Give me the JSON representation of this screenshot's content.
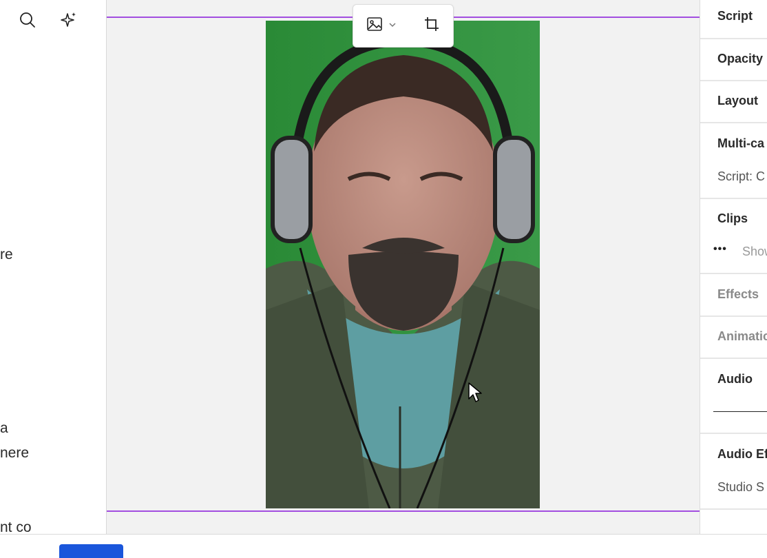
{
  "left_panel": {
    "icons": {
      "search": "search-icon",
      "ai": "sparkle-icon"
    },
    "text_fragments": [
      "re",
      "a",
      "nere",
      "nt co"
    ]
  },
  "canvas": {
    "toolbar": {
      "image_button": "image-icon",
      "dropdown": "chevron-down-icon",
      "crop_button": "crop-icon"
    },
    "guide_color": "#a24de0",
    "video_background": "#2d8b3a"
  },
  "right_panel": {
    "sections": {
      "script": "Script",
      "opacity": "Opacity",
      "layout": "Layout",
      "multicam": "Multi-ca",
      "multicam_sub": "Script: C",
      "clips": "Clips",
      "clips_sub": "Show",
      "effects": "Effects",
      "animation": "Animatic",
      "audio": "Audio",
      "audio_effects": "Audio Ef",
      "audio_effects_sub": "Studio S"
    },
    "more_glyph": "•••"
  },
  "colors": {
    "accent": "#1a56db",
    "guide": "#a24de0"
  }
}
